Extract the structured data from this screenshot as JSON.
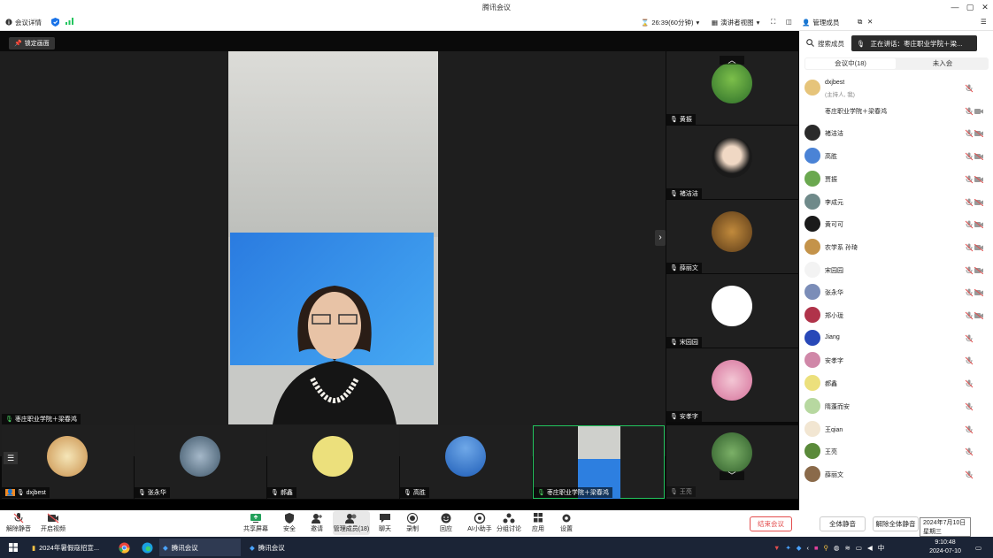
{
  "window": {
    "title": "腾讯会议"
  },
  "topbar": {
    "meeting_details": "会议详情",
    "timer": "26:39(60分钟)",
    "view_mode": "演讲者视图",
    "manage_members": "管理成员"
  },
  "stage": {
    "pin_label": "锁定画面",
    "main_speaker": "枣庄职业学院＋梁春鸿"
  },
  "side_tiles": [
    {
      "name": "黄振"
    },
    {
      "name": "褚洁洁"
    },
    {
      "name": "薛丽文"
    },
    {
      "name": "宋园园"
    },
    {
      "name": "安孝字"
    },
    {
      "name": "王亮"
    }
  ],
  "bottom_tiles": [
    {
      "name": "dxjbest"
    },
    {
      "name": "张永华"
    },
    {
      "name": "郝鑫"
    },
    {
      "name": "高胜"
    },
    {
      "name": "枣庄职业学院＋梁春鸿"
    }
  ],
  "toolbar": {
    "unmute": "解除静音",
    "start_video": "开启视频",
    "share_screen": "共享屏幕",
    "security": "安全",
    "invite": "邀请",
    "manage_members": "管理成员(18)",
    "chat": "聊天",
    "record": "录制",
    "reactions": "回应",
    "ai_assistant": "AI小助手",
    "breakout": "分组讨论",
    "apps": "应用",
    "settings": "设置",
    "end_meeting": "结束会议"
  },
  "panel": {
    "search_placeholder": "搜索成员",
    "speaking": "正在讲话：枣庄职业学院＋梁...",
    "tab_in_meeting": "会议中(18)",
    "tab_not_joined": "未入会",
    "members": [
      {
        "name": "dxjbest",
        "sub": "(主持人, 我)"
      },
      {
        "name": "枣庄职业学院＋梁春鸿",
        "sub": ""
      },
      {
        "name": "褚洁洁",
        "sub": ""
      },
      {
        "name": "高胜",
        "sub": ""
      },
      {
        "name": "贾振",
        "sub": ""
      },
      {
        "name": "李成元",
        "sub": ""
      },
      {
        "name": "黄可可",
        "sub": ""
      },
      {
        "name": "农学系 孙琦",
        "sub": ""
      },
      {
        "name": "宋园园",
        "sub": ""
      },
      {
        "name": "张永华",
        "sub": ""
      },
      {
        "name": "郑小珑",
        "sub": ""
      },
      {
        "name": "Jiang",
        "sub": ""
      },
      {
        "name": "安孝字",
        "sub": ""
      },
      {
        "name": "郝鑫",
        "sub": ""
      },
      {
        "name": "隋蓬而安",
        "sub": ""
      },
      {
        "name": "王qian",
        "sub": ""
      },
      {
        "name": "王亮",
        "sub": ""
      },
      {
        "name": "薛丽文",
        "sub": ""
      }
    ],
    "mute_all": "全体静音",
    "unmute_all": "解除全体静音"
  },
  "tooltip": {
    "date": "2024年7月10日",
    "weekday": "星期三"
  },
  "taskbar": {
    "task1": "2024年暑假寇招宣...",
    "task2": "腾讯会议",
    "task3": "腾讯会议",
    "time": "9:10:48",
    "date": "2024-07-10"
  },
  "colors": {
    "accent": "#1a73e8",
    "end": "#e34d4d",
    "active_border": "#22c55e"
  }
}
